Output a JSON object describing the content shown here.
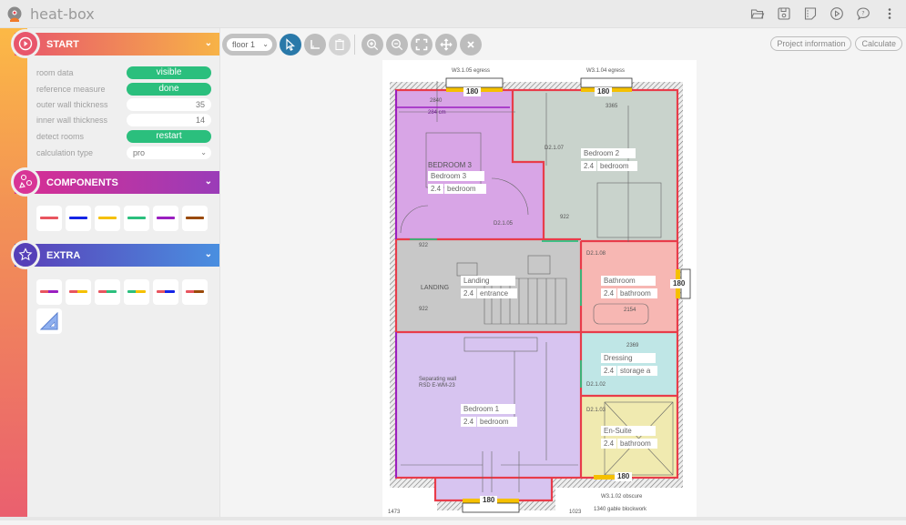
{
  "app": {
    "title": "heat-box"
  },
  "topbar_icons": [
    "folder-open-icon",
    "save-icon",
    "notes-icon",
    "play-icon",
    "help-chat-icon",
    "more-vertical-icon"
  ],
  "sections": {
    "start": {
      "label": "START",
      "icon": "play-circle-icon"
    },
    "components": {
      "label": "COMPONENTS",
      "icon": "shapes-icon"
    },
    "extra": {
      "label": "EXTRA",
      "icon": "star-outline-icon"
    }
  },
  "start_rows": [
    {
      "label": "room data",
      "type": "pill",
      "value": "visible"
    },
    {
      "label": "reference measure",
      "type": "pill",
      "value": "done"
    },
    {
      "label": "outer wall thickness",
      "type": "number",
      "value": "35"
    },
    {
      "label": "inner wall thickness",
      "type": "number",
      "value": "14"
    },
    {
      "label": "detect rooms",
      "type": "pill",
      "value": "restart"
    },
    {
      "label": "calculation type",
      "type": "select",
      "value": "pro"
    }
  ],
  "component_colors": [
    "#e8555f",
    "#1424e6",
    "#f5c000",
    "#2bbf7d",
    "#9a1fc0",
    "#9a4a0a"
  ],
  "extra_pairs": [
    [
      "#e8555f",
      "#9a1fc0"
    ],
    [
      "#e8555f",
      "#f5c000"
    ],
    [
      "#e8555f",
      "#2bbf7d"
    ],
    [
      "#2bbf7d",
      "#f5c000"
    ],
    [
      "#e8555f",
      "#1424e6"
    ],
    [
      "#e8555f",
      "#9a4a0a"
    ]
  ],
  "extra_tool": "set-square-icon",
  "toolbar": {
    "floor": "floor 1",
    "buttons": [
      "select-pointer-icon",
      "measure-angle-icon",
      "delete-icon",
      "zoom-in-icon",
      "zoom-out-icon",
      "fit-screen-icon",
      "pan-move-icon",
      "close-icon"
    ],
    "project_info": "Project information",
    "calculate": "Calculate"
  },
  "rooms": [
    {
      "name": "Bedroom 3",
      "height": "2.4",
      "type": "bedroom",
      "color": "#d8a5e6"
    },
    {
      "name": "Bedroom 2",
      "height": "2.4",
      "type": "bedroom",
      "color": "#c9d3cc"
    },
    {
      "name": "Landing",
      "height": "2.4",
      "type": "entrance",
      "color": "#c8c8c8"
    },
    {
      "name": "Bathroom",
      "height": "2.4",
      "type": "bathroom",
      "color": "#f7b7b3"
    },
    {
      "name": "Dressing",
      "height": "2.4",
      "type": "storage a",
      "color": "#bfe6e6"
    },
    {
      "name": "Bedroom 1",
      "height": "2.4",
      "type": "bedroom",
      "color": "#d7c4f0"
    },
    {
      "name": "En-Suite",
      "height": "2.4",
      "type": "bathroom",
      "color": "#f0eab0"
    }
  ],
  "windows": [
    "180",
    "180",
    "180",
    "180",
    "180"
  ],
  "plan_labels": {
    "w1": "W3.1.05 egress",
    "w2": "W3.1.04 egress",
    "w3": "W3.1.02 obscure",
    "gable": "1340 gable blockwork",
    "bedroom3_caps": "BEDROOM 3",
    "landing_caps": "LANDING",
    "dim_2840": "2840",
    "dim_284cm": "284 cm",
    "dim_3365": "3365",
    "dim_2369": "2369",
    "dim_2154": "2154",
    "dim_922a": "922",
    "dim_922b": "922",
    "dim_922c": "922",
    "dim_1473": "1473",
    "dim_1023": "1023",
    "d_2105": "D2.1.05",
    "d_2107": "D2.1.07",
    "d_2108": "D2.1.08",
    "d_2102": "D2.1.02",
    "d_2103": "D2.1.03",
    "sep_wall": "Separating wall",
    "rsd": "RSD E-WM-23"
  }
}
